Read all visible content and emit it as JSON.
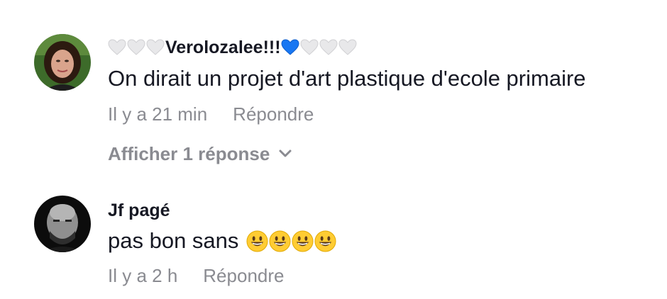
{
  "comments": [
    {
      "username": "Verolozalee!!!",
      "username_prefix_icons": [
        "white-heart-icon",
        "white-heart-icon",
        "white-heart-icon"
      ],
      "username_suffix_icons": [
        "blue-heart-icon",
        "white-heart-icon",
        "white-heart-icon",
        "white-heart-icon"
      ],
      "text": "On dirait un projet d'art plastique d'ecole primaire",
      "time": "Il y a 21 min",
      "reply_label": "Répondre",
      "view_replies_label": "Afficher 1 réponse",
      "view_replies_icon": "chevron-down-icon"
    },
    {
      "username": "Jf pagé",
      "text": "pas bon sans",
      "text_emojis": [
        "grinning-face-icon",
        "grinning-face-icon",
        "grinning-face-icon",
        "grinning-face-icon"
      ],
      "time": "Il y a 2 h",
      "reply_label": "Répondre"
    }
  ],
  "colors": {
    "primary_text": "#161823",
    "secondary_text": "#8a8b91",
    "blue_heart": "#1877f2",
    "white_heart": "#e8e8ea"
  }
}
